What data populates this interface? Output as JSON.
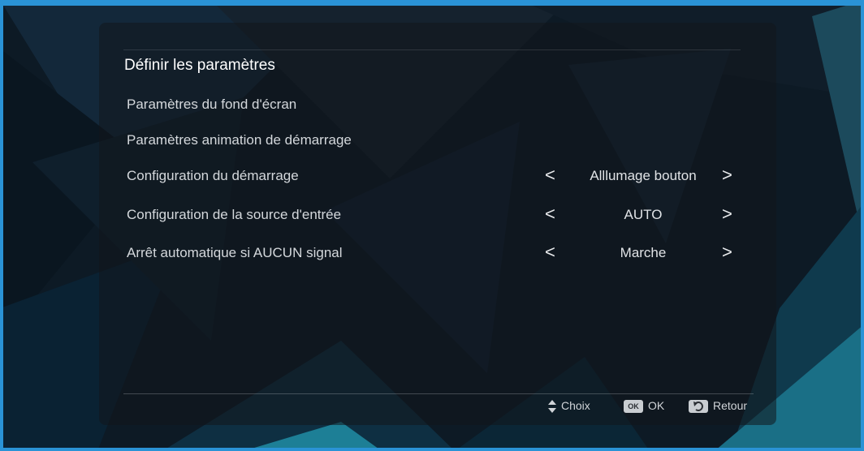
{
  "title": "Définir les paramètres",
  "menu": {
    "items": [
      {
        "label": "Paramètres du fond d'écran"
      },
      {
        "label": "Paramètres animation de démarrage"
      },
      {
        "label": "Configuration du démarrage",
        "value": "Alllumage bouton"
      },
      {
        "label": "Configuration de la source d'entrée",
        "value": "AUTO"
      },
      {
        "label": "Arrêt automatique si AUCUN signal",
        "value": "Marche"
      }
    ],
    "arrow_left": "<",
    "arrow_right": ">"
  },
  "footer": {
    "choice_label": "Choix",
    "ok_badge": "OK",
    "ok_label": "OK",
    "back_label": "Retour"
  },
  "colors": {
    "frame": "#2a93d6",
    "background": "#0c1a26",
    "accent_teal": "#1fa0b0"
  },
  "icons": {
    "choice": "up-down-arrows-icon",
    "ok": "ok-key-icon",
    "back": "return-arrow-icon"
  }
}
